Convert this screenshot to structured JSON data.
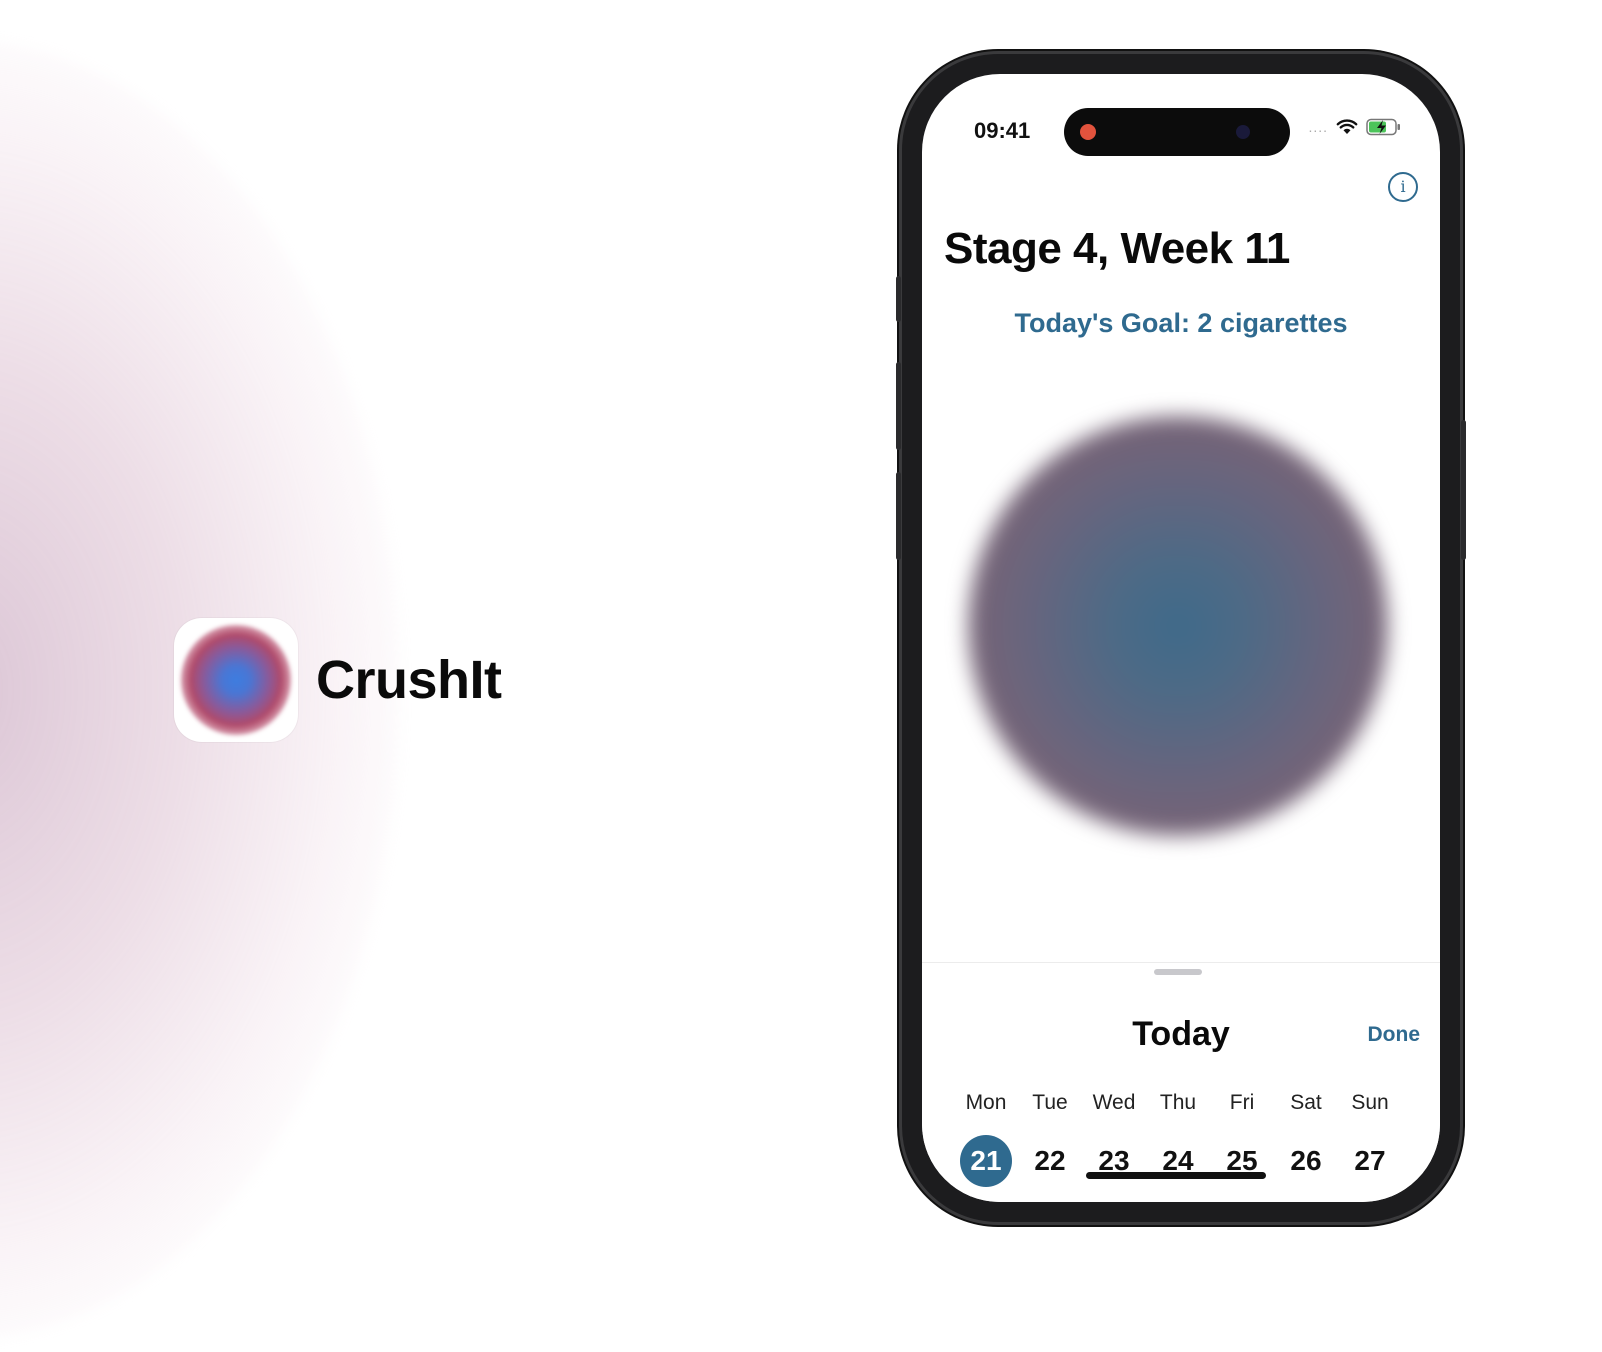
{
  "brand": {
    "name": "CrushIt",
    "icon": "gradient-orb-app-icon"
  },
  "status_bar": {
    "time": "09:41",
    "signal": "....",
    "icons": [
      "wifi-icon",
      "battery-charging-icon"
    ]
  },
  "header": {
    "info_icon": "info-icon",
    "info_glyph": "i",
    "title": "Stage 4, Week 11",
    "goal": "Today's Goal: 2 cigarettes"
  },
  "sheet": {
    "title": "Today",
    "done_label": "Done",
    "days": [
      {
        "name": "Mon",
        "num": "21",
        "selected": true
      },
      {
        "name": "Tue",
        "num": "22",
        "selected": false
      },
      {
        "name": "Wed",
        "num": "23",
        "selected": false
      },
      {
        "name": "Thu",
        "num": "24",
        "selected": false
      },
      {
        "name": "Fri",
        "num": "25",
        "selected": false
      },
      {
        "name": "Sat",
        "num": "26",
        "selected": false
      },
      {
        "name": "Sun",
        "num": "27",
        "selected": false
      }
    ]
  },
  "colors": {
    "accent": "#2f6a8f",
    "record": "#e2533d"
  }
}
